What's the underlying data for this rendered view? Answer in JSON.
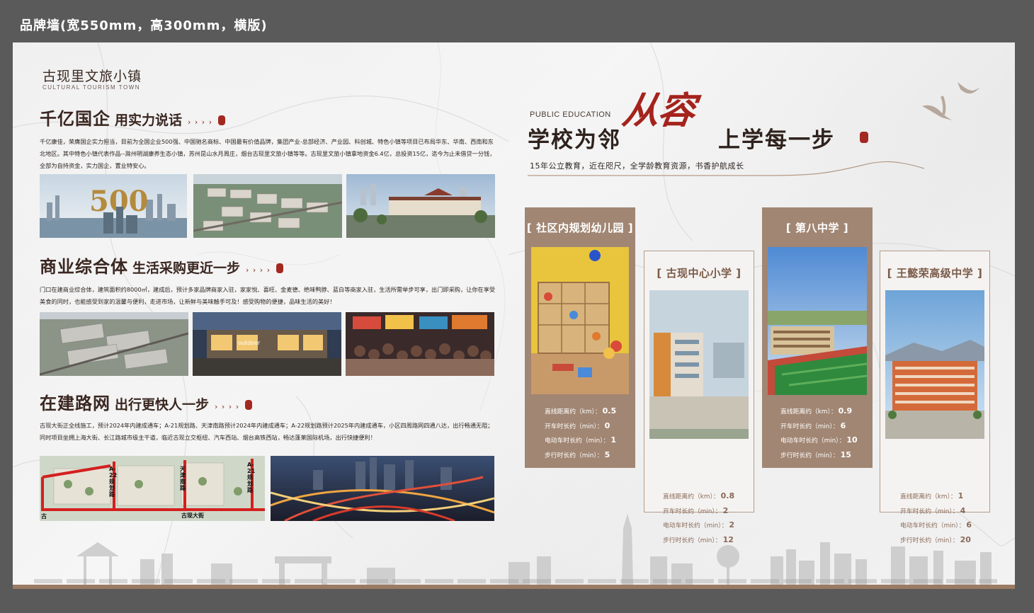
{
  "caption": "品牌墙(宽550mm，高300mm，横版)",
  "brand": {
    "name": "古现里文旅小镇",
    "subtitle": "CULTURAL TOURISM TOWN"
  },
  "sections": [
    {
      "title_big": "千亿国企",
      "title_small": "用实力说话",
      "arrows": "› › › ›",
      "text": "千亿康佳，荣膺国企实力担当，目前为全国企业500强、中国驰名商标、中国最有价值品牌，集团产业-总部经济、产业园、科创城、特色小镇等项目已布局华东、华南、西南和东北地区。其中特色小镇代表作品--滁州明湖康养生态小镇，苏州昆山水月周庄，烟台古现里文旅小镇等等。古现里文旅小镇拿地资金6.4亿，总投资15亿，迄今为止未借贷一分钱，全部为自持资金，实力国企，置业特安心。",
      "photos": [
        "city-skyline-500",
        "aerial-town-render",
        "street-render"
      ]
    },
    {
      "title_big": "商业综合体",
      "title_small": "生活采购更近一步",
      "arrows": "› › › ›",
      "text": "门口在建商业综合体，建筑面积约8000㎡，建成后，预计多家品牌商家入驻，家家悦、喜旺、金麦德、绝味鸭脖、蓝白等商家入驻，生活所需举步可享，出门即采购，让你在享受美食的同时，也能感受到家的温馨与便利，走进市场，让新鲜与美味触手可及！感受购物的便捷，品味生活的美好！",
      "photos": [
        "commercial-aerial",
        "shopping-street-night",
        "food-market-crowd"
      ]
    },
    {
      "title_big": "在建路网",
      "title_small": "出行更快人一步",
      "arrows": "› › › ›",
      "text": "古现大街正全线施工，预计2024年内建成通车；A-21规划路、天津南路预计2024年内建成通车；A-22规划路预计2025年内建成通车，小区四周路网四通八达，出行畅通无阻；同时项目坐拥上海大街、长江路城市级主干道，临近古现立交枢纽、汽车西站、烟台高铁西站，畅达蓬莱国际机场，出行快捷便利！",
      "photos": [
        "road-network-map",
        "highway-interchange-night"
      ],
      "map_labels": [
        "A-22规划路",
        "天津南路",
        "A-21规划路",
        "古现大街",
        "古"
      ]
    }
  ],
  "education": {
    "label": "PUBLIC EDUCATION",
    "title_left": "学校为邻",
    "title_calligraphy": "从容",
    "title_right": "上学每一步",
    "description": "15年公立教育，近在咫尺，全学龄教育资源，书香护航成长",
    "stat_labels": [
      "直线距离约（km）：",
      "开车时长约（min）：",
      "电动车时长约（min）：",
      "步行时长约（min）："
    ],
    "schools": [
      {
        "name": "[ 社区内规划幼儿园 ]",
        "photo": "kindergarten-classroom",
        "values": [
          "0.5",
          "0",
          "1",
          "5"
        ]
      },
      {
        "name": "[ 古现中心小学 ]",
        "photo": "primary-school-building",
        "values": [
          "0.8",
          "2",
          "2",
          "12"
        ]
      },
      {
        "name": "[ 第八中学 ]",
        "photo": "middle-school-campus",
        "values": [
          "0.9",
          "6",
          "10",
          "15"
        ]
      },
      {
        "name": "[ 王懿荣高级中学 ]",
        "photo": "high-school-building",
        "values": [
          "1",
          "4",
          "6",
          "20"
        ]
      }
    ]
  },
  "colors": {
    "accent_red": "#a4231c",
    "brown_card": "#a18673",
    "dark_text": "#2f221d",
    "background_frame": "#5a5a5a"
  }
}
